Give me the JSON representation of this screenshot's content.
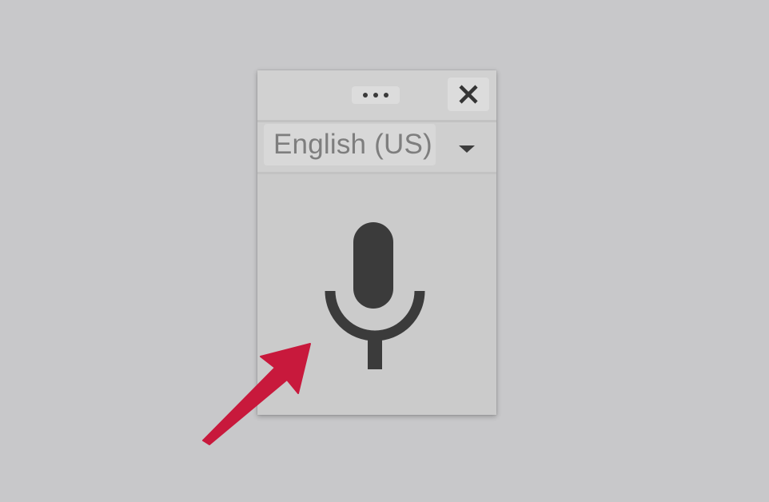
{
  "window": {
    "more_icon": "more-horizontal-icon",
    "close_icon": "close-icon"
  },
  "language": {
    "selected": "English (US)",
    "dropdown_icon": "caret-down-icon"
  },
  "mic": {
    "icon": "microphone-icon",
    "color": "#3b3b3b"
  },
  "annotation": {
    "arrow_icon": "arrow-pointer-icon",
    "color": "#c8193c"
  }
}
